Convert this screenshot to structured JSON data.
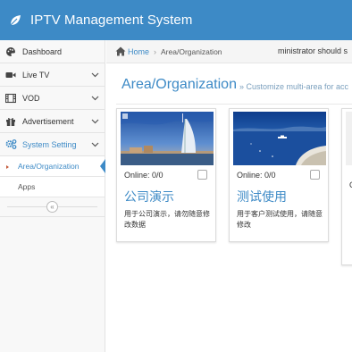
{
  "app": {
    "title": "IPTV Management System"
  },
  "sidebar": {
    "items": [
      {
        "label": "Dashboard",
        "icon": "palette-icon"
      },
      {
        "label": "Live TV",
        "icon": "video-camera-icon"
      },
      {
        "label": "VOD",
        "icon": "film-icon"
      },
      {
        "label": "Advertisement",
        "icon": "gift-icon"
      },
      {
        "label": "System Setting",
        "icon": "gears-icon"
      }
    ],
    "subitems": [
      {
        "label": "Area/Organization"
      },
      {
        "label": "Apps"
      }
    ],
    "collapse_glyph": "«"
  },
  "breadcrumb": {
    "home": "Home",
    "separator": "›",
    "current": "Area/Organization",
    "notice": "ministrator should s"
  },
  "page": {
    "title": "Area/Organization",
    "subtitle": "» Customize multi-area for acc"
  },
  "cards": [
    {
      "online": "Online: 0/0",
      "name": "公司演示",
      "description": "用于公司演示，请勿随意修改数据"
    },
    {
      "online": "Online: 0/0",
      "name": "测试使用",
      "description": "用于客户测试使用，请随意修改"
    }
  ],
  "partial_card": {
    "text": "C"
  },
  "colors": {
    "primary": "#3d8ac6",
    "sidebar_bg": "#f8f8f8",
    "accent_marker": "#c45a3a"
  }
}
